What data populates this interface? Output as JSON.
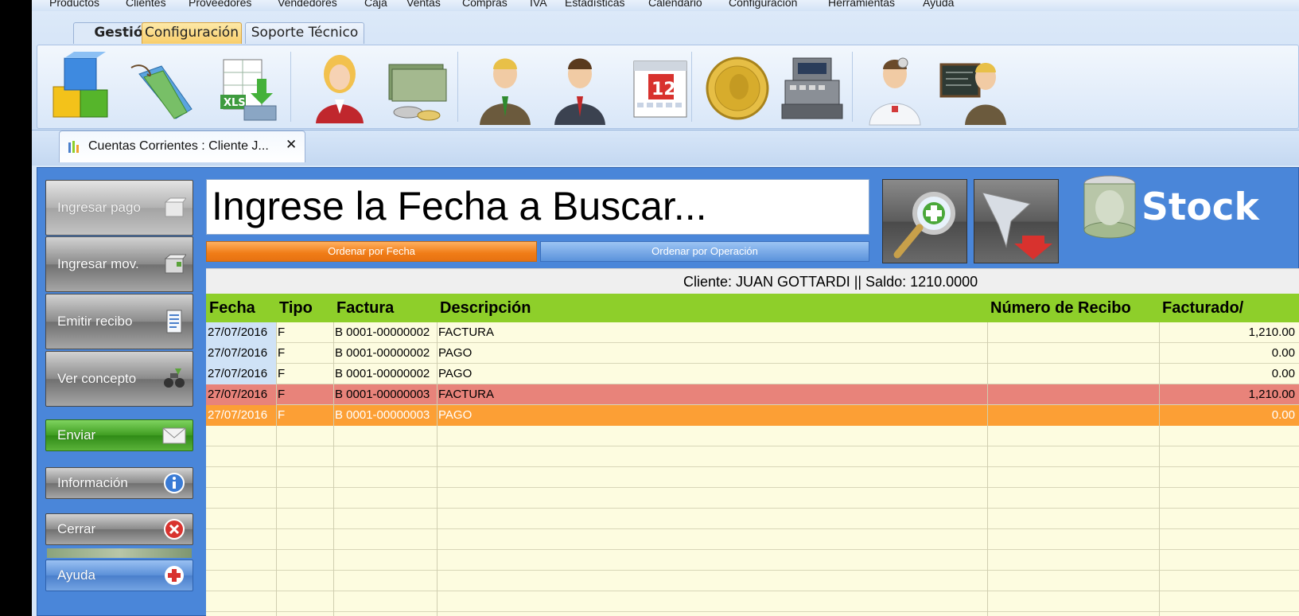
{
  "menu": [
    "Productos",
    "Clientes",
    "Proveedores",
    "Vendedores",
    "Caja",
    "Ventas",
    "Compras",
    "IVA",
    "Estadísticas",
    "Calendario",
    "Configuración",
    "Herramientas",
    "Ayuda"
  ],
  "ribbon": {
    "tabs": {
      "gestion": "Gestión",
      "config": "Configuración",
      "soporte": "Soporte Técnico"
    },
    "icons": [
      "productos-icon",
      "etiquetas-icon",
      "excel-import-icon",
      "clientes-icon",
      "dinero-icon",
      "proveedores-icon",
      "vendedores-icon",
      "calendario-icon",
      "moneda-icon",
      "caja-registradora-icon",
      "soporte-medico-icon",
      "profesor-icon"
    ],
    "calendar_day": "12",
    "xls": "XLS"
  },
  "doctab": {
    "title": "Cuentas Corrientes : Cliente J...",
    "close": "✕"
  },
  "sidebar": {
    "ingresar_pago": "Ingresar pago",
    "ingresar_mov": "Ingresar mov.",
    "emitir_recibo": "Emitir recibo",
    "ver_concepto": "Ver concepto",
    "enviar": "Enviar",
    "informacion": "Información",
    "cerrar": "Cerrar",
    "ayuda": "Ayuda"
  },
  "search": {
    "text": "Ingrese la Fecha a Buscar..."
  },
  "sort": {
    "fecha": "Ordenar por Fecha",
    "operacion": "Ordenar por Operación"
  },
  "brand": "Stock",
  "client": {
    "label": "Cliente: JUAN GOTTARDI || Saldo: 1210.0000"
  },
  "table": {
    "headers": {
      "fecha": "Fecha",
      "tipo": "Tipo",
      "factura": "Factura",
      "descripcion": "Descripción",
      "recibo": "Número de Recibo",
      "facturado": "Facturado/"
    },
    "rows": [
      {
        "fecha": "27/07/2016",
        "tipo": "F",
        "factura": "B 0001-00000002",
        "descripcion": "FACTURA",
        "recibo": "",
        "facturado": "1,210.00"
      },
      {
        "fecha": "27/07/2016",
        "tipo": "F",
        "factura": "B 0001-00000002",
        "descripcion": "PAGO",
        "recibo": "",
        "facturado": "0.00"
      },
      {
        "fecha": "27/07/2016",
        "tipo": "F",
        "factura": "B 0001-00000002",
        "descripcion": "PAGO",
        "recibo": "",
        "facturado": "0.00"
      },
      {
        "fecha": "27/07/2016",
        "tipo": "F",
        "factura": "B 0001-00000003",
        "descripcion": "FACTURA",
        "recibo": "",
        "facturado": "1,210.00"
      },
      {
        "fecha": "27/07/2016",
        "tipo": "F",
        "factura": "B 0001-00000003",
        "descripcion": "PAGO",
        "recibo": "",
        "facturado": "0.00"
      }
    ]
  },
  "colors": {
    "header_green": "#8ecf2a",
    "row_red": "#e8837a",
    "row_orange": "#fc9f35",
    "main_blue": "#4a86d9"
  }
}
